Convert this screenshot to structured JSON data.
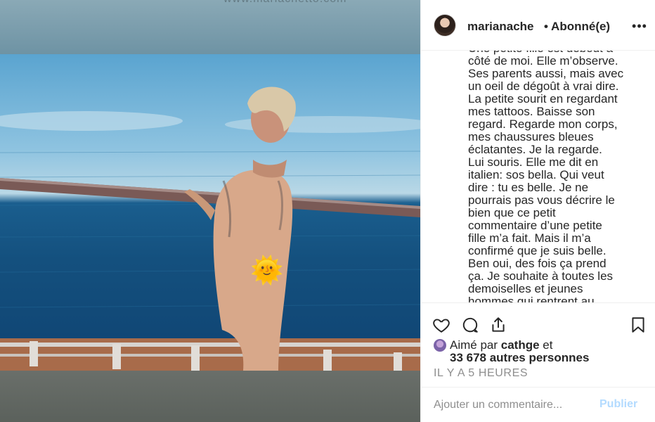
{
  "media": {
    "watermark": "www.mariachetto.com",
    "sticker": "🌞"
  },
  "header": {
    "username": "marianache",
    "separator": "•",
    "follow_state": "Abonné(e)",
    "more": "•••"
  },
  "caption": {
    "text": "Une petite fille est debout à\ncôté de moi. Elle m’observe.\nSes parents aussi, mais avec\nun oeil de dégoût à vrai dire.\nLa petite sourit en regardant\nmes tattoos. Baisse son\nregard. Regarde mon corps,\nmes chaussures bleues\néclatantes. Je la regarde.\nLui souris. Elle me dit en\nitalien: sos bella. Qui veut\ndire : tu es belle. Je ne\npourrais pas vous décrire le\nbien que ce petit\ncommentaire d’une petite\nfille m’a fait. Mais il m’a\nconfirmé que je suis belle.\nBen oui, des fois ça prend\nça. Je souhaite à toutes les\ndemoiselles et jeunes\nhommes qui rentrent au"
  },
  "actions": {
    "icons": [
      "heart-icon",
      "comment-icon",
      "share-icon",
      "bookmark-icon"
    ]
  },
  "likes": {
    "prefix": "Aimé par ",
    "liker": "cathge",
    "suffix": " et",
    "others": "33 678 autres personnes"
  },
  "timestamp": "IL Y A 5 HEURES",
  "comment": {
    "placeholder": "Ajouter un commentaire...",
    "publish_label": "Publier"
  }
}
